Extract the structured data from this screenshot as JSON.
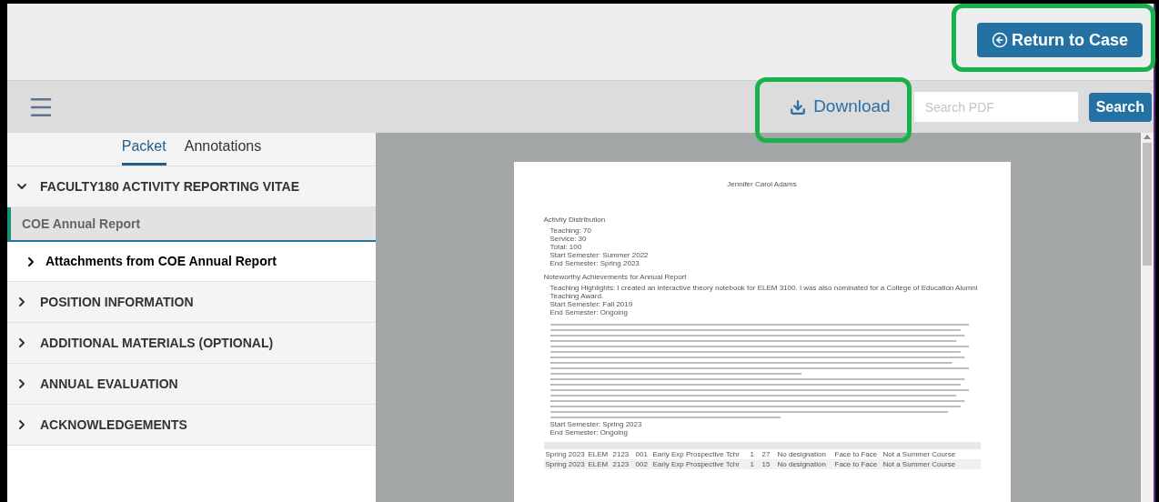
{
  "header": {
    "return_button": {
      "label": "Return to Case",
      "highlighted": true
    }
  },
  "toolbar": {
    "download_button": {
      "label": "Download",
      "highlighted": true
    },
    "search": {
      "placeholder": "Search PDF"
    },
    "search_button": "Search"
  },
  "sidebar": {
    "tabs": [
      {
        "label": "Packet",
        "selected": true
      },
      {
        "label": "Annotations",
        "selected": false
      }
    ],
    "sections": [
      {
        "label": "FACULTY180 ACTIVITY REPORTING VITAE",
        "expanded": true,
        "children": [
          {
            "label": "COE Annual Report",
            "selected": true,
            "children": [
              {
                "label": "Attachments from COE Annual Report",
                "expanded": false
              }
            ]
          }
        ]
      },
      {
        "label": "POSITION INFORMATION",
        "expanded": false
      },
      {
        "label": "ADDITIONAL MATERIALS (OPTIONAL)",
        "expanded": false
      },
      {
        "label": "ANNUAL EVALUATION",
        "expanded": false
      },
      {
        "label": "ACKNOWLEDGEMENTS",
        "expanded": false
      }
    ]
  },
  "document": {
    "name": "Jennifer Carol Adams",
    "blocks": [
      {
        "kind": "text",
        "heading": "Activity Distribution",
        "lines": [
          "Teaching: 70",
          "Service: 30",
          "Total: 100",
          "Start Semester: Summer 2022",
          "End Semester: Spring 2023"
        ]
      },
      {
        "kind": "text",
        "heading": "Noteworthy Achievements for Annual Report",
        "lines": [
          "Teaching Highlights: I created an interactive theory notebook for ELEM 3100. I was also nominated for a College of Education Alumni Teaching Award.",
          "Start Semester: Fall 2019",
          "End Semester: Ongoing"
        ]
      },
      {
        "kind": "blurred",
        "lines": [
          "Start Semester: Spring 2023",
          "End Semester: Ongoing"
        ]
      }
    ],
    "table": {
      "rows": [
        [
          "Spring 2023",
          "ELEM",
          "2123",
          "001",
          "Early Exp Prospective Tchr",
          "1",
          "27",
          "No designation",
          "Face to Face",
          "Not a Summer Course"
        ],
        [
          "Spring 2023",
          "ELEM",
          "2123",
          "002",
          "Early Exp Prospective Tchr",
          "1",
          "15",
          "No designation",
          "Face to Face",
          "Not a Summer Course"
        ]
      ]
    }
  }
}
